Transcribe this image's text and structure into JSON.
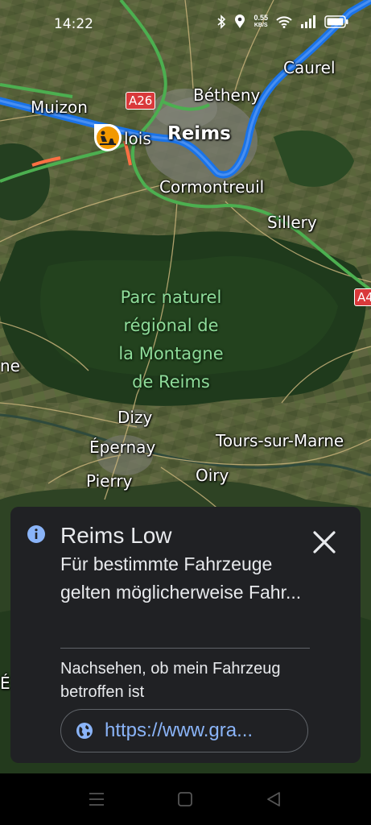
{
  "status_bar": {
    "time": "14:22",
    "net_speed_value": "0.55",
    "net_speed_unit": "KB/S"
  },
  "map": {
    "places": {
      "caurel": "Caurel",
      "betheny": "Bétheny",
      "muizon": "Muizon",
      "tinqueux_partial": "lois",
      "reims": "Reims",
      "cormontreuil": "Cormontreuil",
      "sillery": "Sillery",
      "dizy": "Dizy",
      "epernay": "Épernay",
      "tours_sur_marne": "Tours-sur-Marne",
      "pierry": "Pierry",
      "oiry": "Oiry",
      "left_edge_ne": "ne",
      "left_edge_e": "É"
    },
    "park_lines": [
      "Parc naturel",
      "régional de",
      "la Montagne",
      "de Reims"
    ],
    "road_shields": [
      "A26",
      "A4"
    ]
  },
  "info_card": {
    "title": "Reims Low",
    "description": "Für bestimmte Fahrzeuge gelten möglicherweise Fahr...",
    "check_text": "Nachsehen, ob mein Fahrzeug betroffen ist",
    "url": "https://www.gra..."
  },
  "colors": {
    "route": "#1a73e8",
    "card_bg": "#202124",
    "link": "#8ab4f8",
    "park_label": "#8fdc9a"
  }
}
